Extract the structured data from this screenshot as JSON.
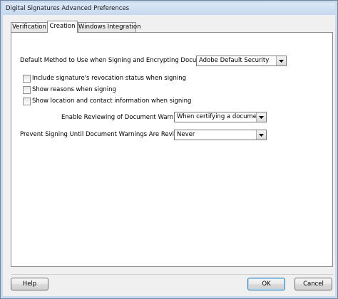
{
  "window": {
    "title": "Digital Signatures Advanced Preferences"
  },
  "tabs": [
    {
      "label": "Verification",
      "active": false
    },
    {
      "label": "Creation",
      "active": true
    },
    {
      "label": "Windows Integration",
      "active": false
    }
  ],
  "creation": {
    "default_method": {
      "label": "Default Method to Use when Signing and Encrypting Documents:",
      "value": "Adobe Default Security"
    },
    "checkboxes": [
      {
        "label": "Include signature's revocation status when signing",
        "checked": false
      },
      {
        "label": "Show reasons when signing",
        "checked": false
      },
      {
        "label": "Show location and contact information when signing",
        "checked": false
      }
    ],
    "warnings_review": {
      "label": "Enable Reviewing of Document Warnings:",
      "value": "When certifying a document"
    },
    "prevent_signing": {
      "label": "Prevent Signing Until Document Warnings Are Reviewed:",
      "value": "Never"
    }
  },
  "buttons": {
    "help": "Help",
    "ok": "OK",
    "cancel": "Cancel"
  },
  "icons": {
    "dropdown": "chevron-down-icon"
  }
}
